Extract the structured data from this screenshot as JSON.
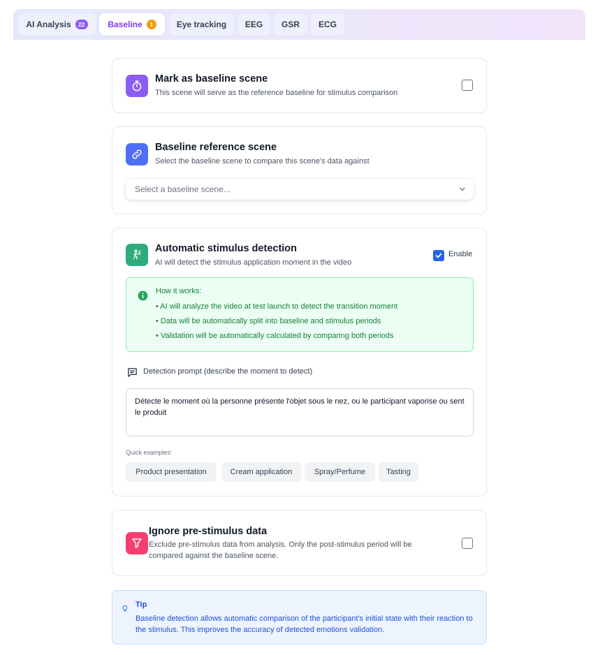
{
  "tabs": [
    {
      "label": "AI Analysis",
      "badge": "22"
    },
    {
      "label": "Baseline",
      "badge": "1"
    },
    {
      "label": "Eye tracking"
    },
    {
      "label": "EEG"
    },
    {
      "label": "GSR"
    },
    {
      "label": "ECG"
    }
  ],
  "active_tab": "Baseline",
  "mark_baseline": {
    "icon": "stopwatch-icon",
    "title": "Mark as baseline scene",
    "description": "This scene will serve as the reference baseline for stimulus comparison",
    "checked": false
  },
  "baseline_reference": {
    "icon": "link-icon",
    "title": "Baseline reference scene",
    "description": "Select the baseline scene to compare this scene's data against",
    "select_placeholder": "Select a baseline scene..."
  },
  "stimulus_detection": {
    "icon": "person-spray-icon",
    "title": "Automatic stimulus detection",
    "description": "AI will detect the stimulus application moment in the video",
    "enable_label": "Enable",
    "enabled": true,
    "how_it_works": {
      "title": "How it works:",
      "items": [
        "• AI will analyze the video at test launch to detect the transition moment",
        "• Data will be automatically split into baseline and stimulus periods",
        "• Validation will be automatically calculated by comparing both periods"
      ]
    },
    "prompt_label": "Detection prompt (describe the moment to detect)",
    "prompt_value": "Détecte le moment où la personne présente l'objet sous le nez, ou le participant vaporise ou sent le produit",
    "quick_examples_label": "Quick examples:",
    "quick_examples": [
      "Product presentation",
      "Cream application",
      "Spray/Perfume",
      "Tasting"
    ]
  },
  "ignore_prestimulus": {
    "icon": "filter-icon",
    "title": "Ignore pre-stimulus data",
    "description_line1": "Exclude pre-stimulus data from analysis. Only the post-stimulus period will be",
    "description_line2": "compared against the baseline scene.",
    "checked": false
  },
  "tip": {
    "icon": "lightbulb-icon",
    "title": "Tip",
    "text": "Baseline detection allows automatic comparison of the participant's initial state with their reaction to the stimulus. This improves the accuracy of detected emotions validation."
  },
  "colors": {
    "accent_purple": "#7c3aed",
    "badge_orange": "#f59e0b",
    "stopwatch_bg": "#8b5cf6",
    "link_bg": "#4f6ef7",
    "stimulus_bg": "#2faa7c",
    "filter_bg": "#f43f6e",
    "checkbox_blue": "#2563eb"
  }
}
